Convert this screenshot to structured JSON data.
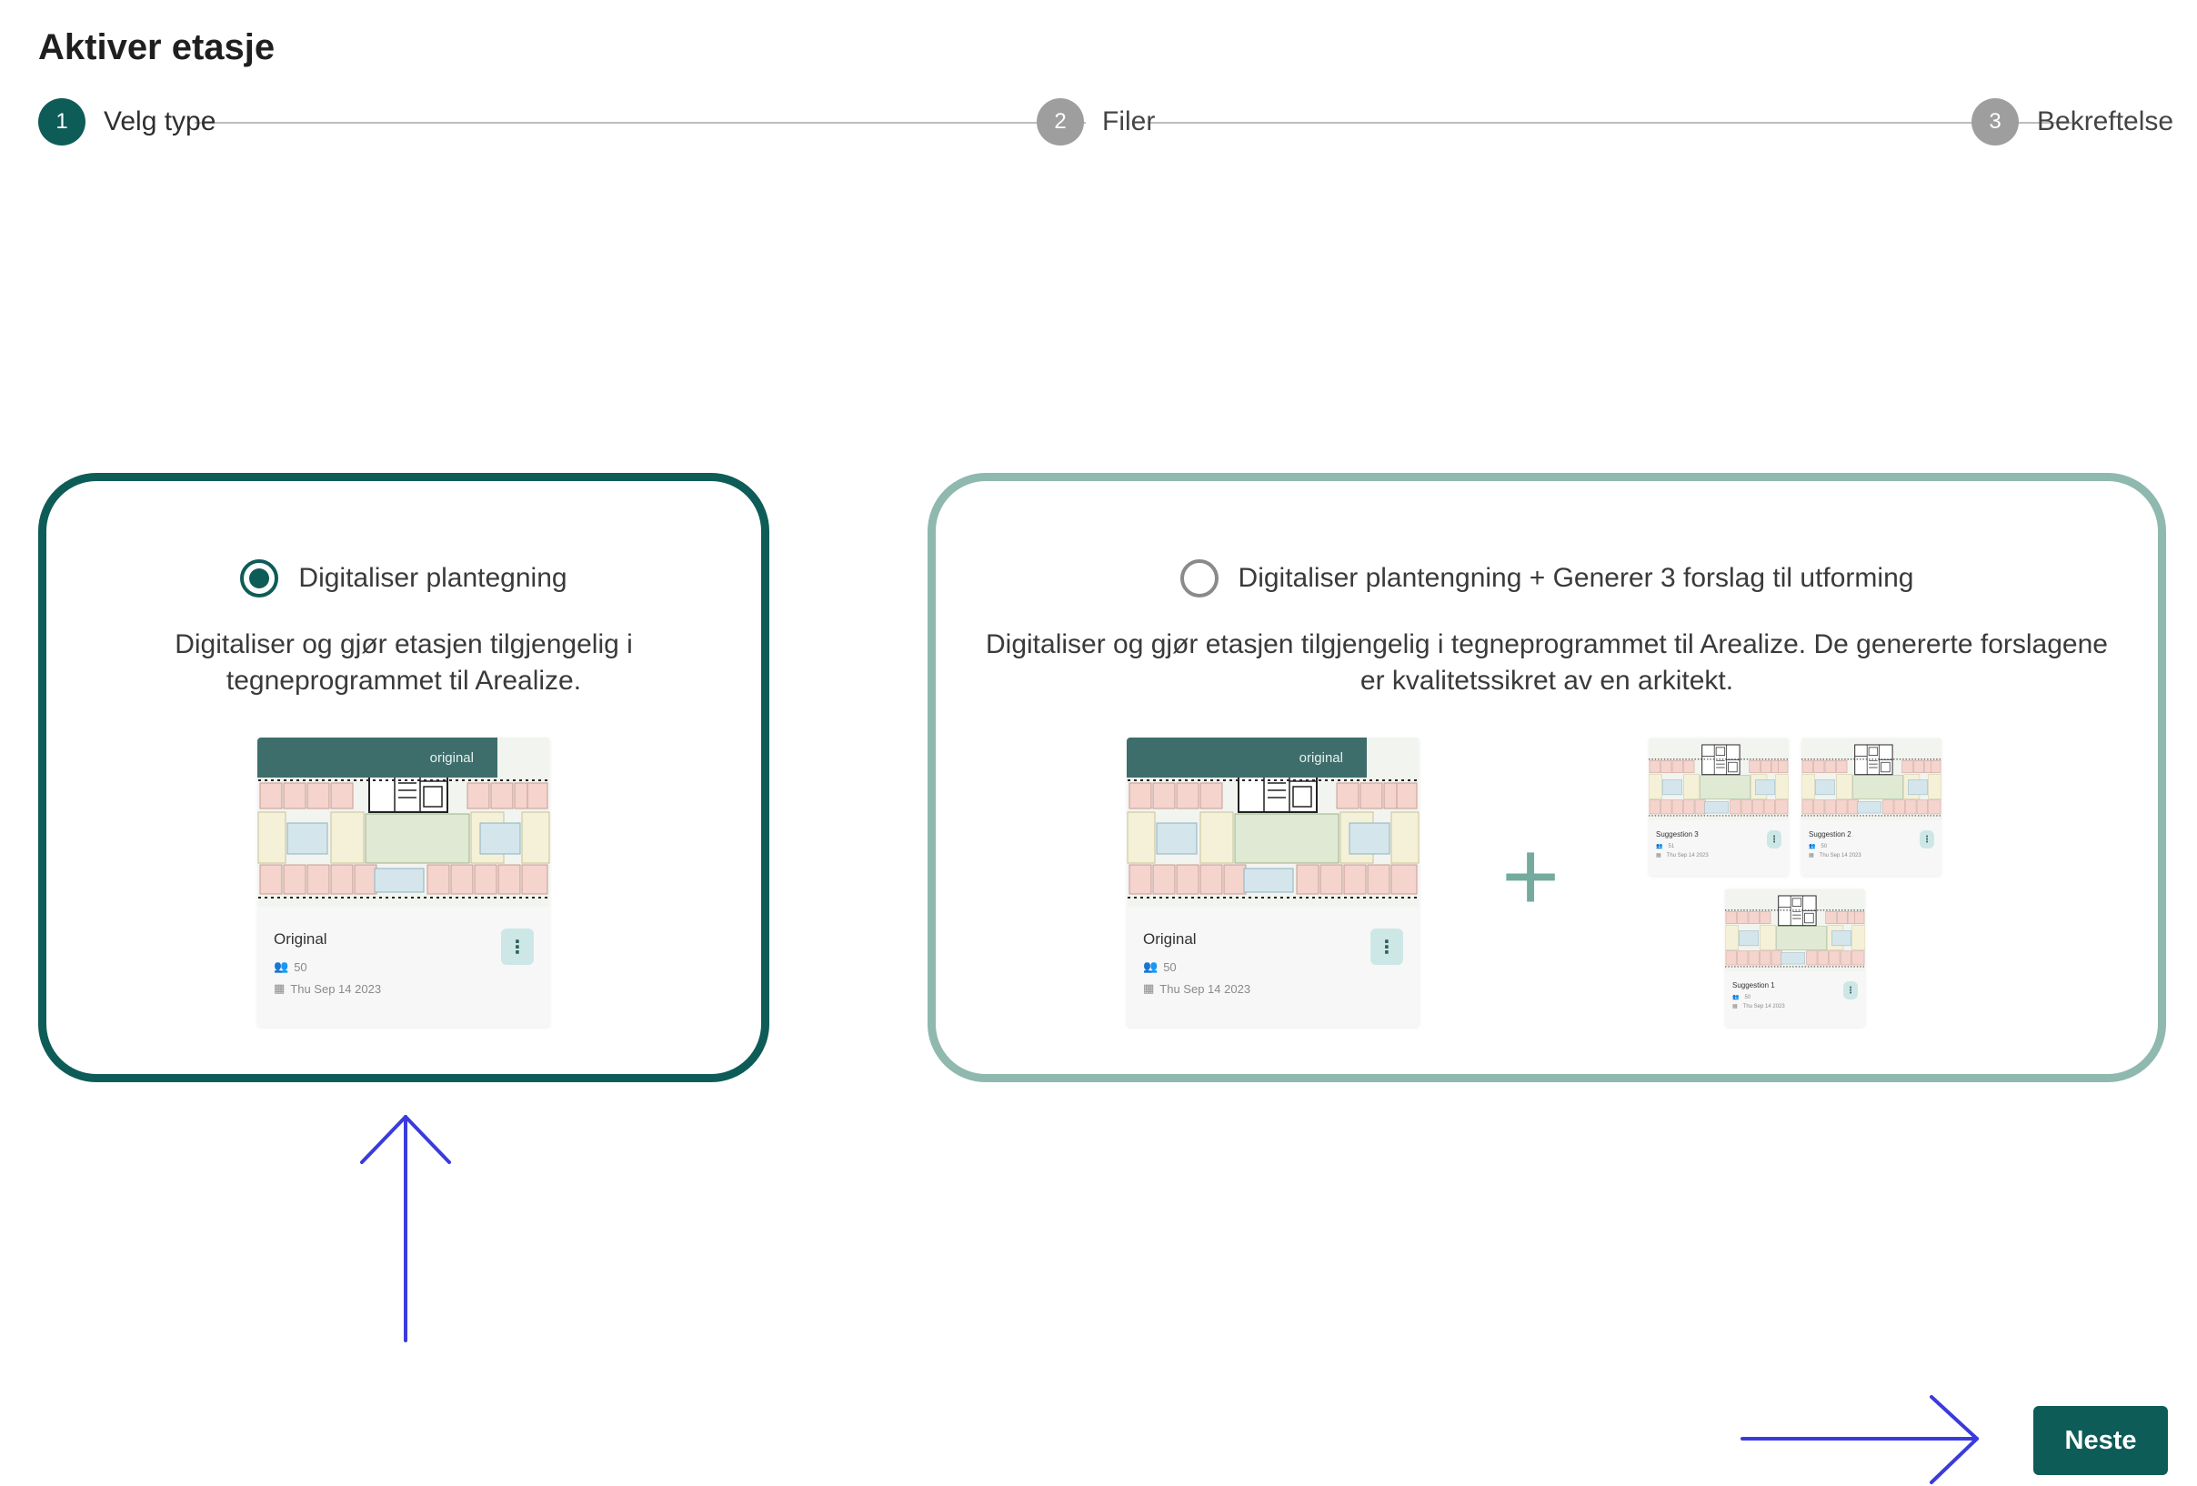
{
  "page": {
    "title": "Aktiver etasje"
  },
  "stepper": {
    "steps": [
      {
        "number": "1",
        "label": "Velg type",
        "state": "active"
      },
      {
        "number": "2",
        "label": "Filer",
        "state": "inactive"
      },
      {
        "number": "3",
        "label": "Bekreftelse",
        "state": "inactive"
      }
    ]
  },
  "options": [
    {
      "label": "Digitaliser plantegning",
      "selected": true,
      "description": "Digitaliser og gjør etasjen tilgjengelig i tegneprogrammet til Arealize.",
      "preview": {
        "tag": "original",
        "name": "Original",
        "people": "50",
        "date": "Thu Sep 14 2023"
      }
    },
    {
      "label": "Digitaliser plantengning + Generer 3 forslag til utforming",
      "selected": false,
      "description": "Digitaliser og gjør etasjen tilgjengelig i tegneprogrammet til Arealize. De genererte forslagene er kvalitetssikret av en arkitekt.",
      "preview": {
        "tag": "original",
        "name": "Original",
        "people": "50",
        "date": "Thu Sep 14 2023"
      },
      "plus": "+",
      "suggestions": [
        {
          "name": "Suggestion 3",
          "people": "51",
          "date": "Thu Sep 14 2023"
        },
        {
          "name": "Suggestion 2",
          "people": "50",
          "date": "Thu Sep 14 2023"
        },
        {
          "name": "Suggestion 1",
          "people": "50",
          "date": "Thu Sep 14 2023"
        }
      ]
    }
  ],
  "footer": {
    "next_label": "Neste"
  },
  "colors": {
    "primary": "#0e5c57",
    "secondary_border": "#8fb8ae",
    "annotation": "#3b3bdc"
  }
}
